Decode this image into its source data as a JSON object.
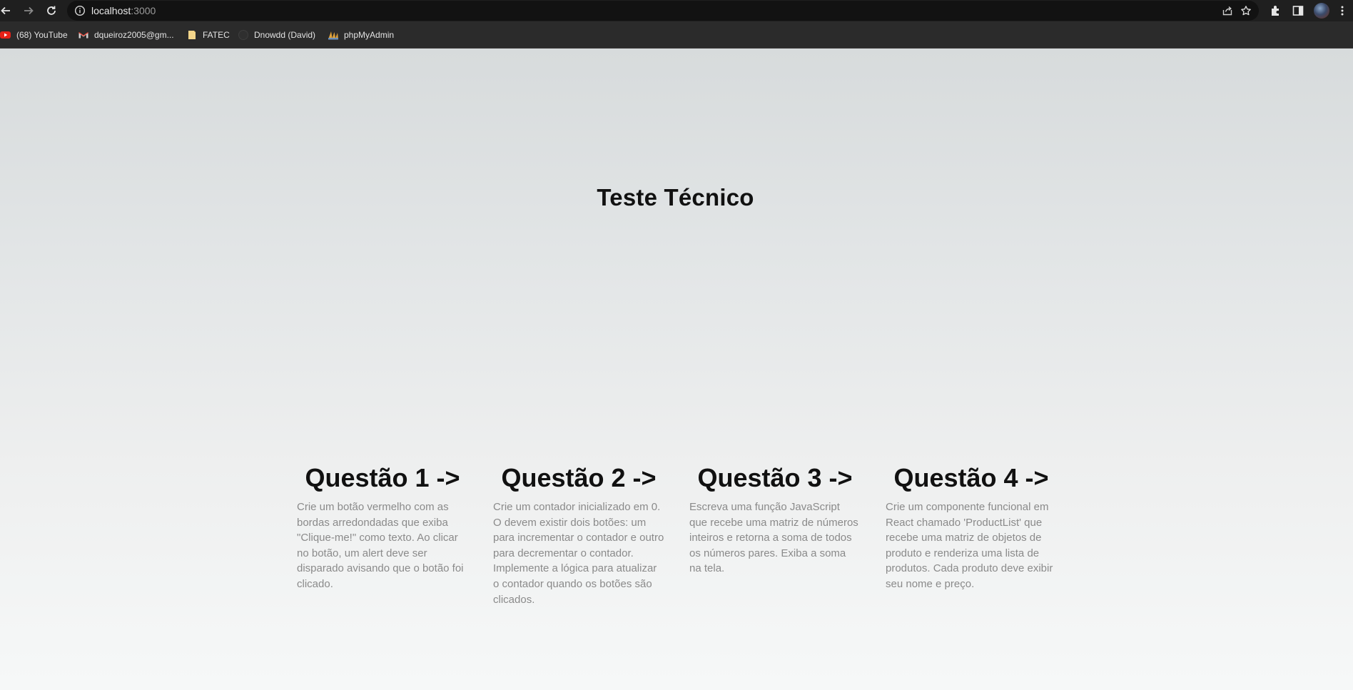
{
  "browser": {
    "url_host": "localhost",
    "url_port": ":3000",
    "bookmarks": [
      {
        "label": "(68) YouTube",
        "icon": "youtube-icon"
      },
      {
        "label": "dqueiroz2005@gm...",
        "icon": "gmail-icon"
      },
      {
        "label": "FATEC",
        "icon": "folder-icon"
      },
      {
        "label": "Dnowdd (David)",
        "icon": "github-icon"
      },
      {
        "label": "phpMyAdmin",
        "icon": "phpmyadmin-icon"
      }
    ]
  },
  "page": {
    "title": "Teste Técnico",
    "cards": [
      {
        "heading": "Questão 1 ->",
        "description": "Crie um botão vermelho com as bordas arredondadas que exiba \"Clique-me!\" como texto. Ao clicar no botão, um alert deve ser disparado avisando que o botão foi clicado."
      },
      {
        "heading": "Questão 2 ->",
        "description": "Crie um contador inicializado em 0. O devem existir dois botões: um para incrementar o contador e outro para decrementar o contador. Implemente a lógica para atualizar o contador quando os botões são clicados."
      },
      {
        "heading": "Questão 3 ->",
        "description": "Escreva uma função JavaScript que recebe uma matriz de números inteiros e retorna a soma de todos os números pares. Exiba a soma na tela."
      },
      {
        "heading": "Questão 4 ->",
        "description": "Crie um componente funcional em React chamado 'ProductList' que recebe uma matriz de objetos de produto e renderiza uma lista de produtos. Cada produto deve exibir seu nome e preço."
      }
    ]
  },
  "colors": {
    "title": "#111111",
    "description": "#8a8a8a",
    "chrome_dark": "#1f1f1f"
  }
}
